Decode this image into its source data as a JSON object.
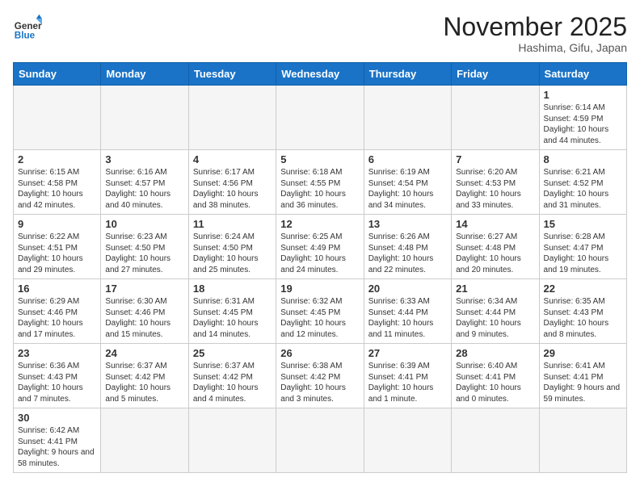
{
  "header": {
    "logo_general": "General",
    "logo_blue": "Blue",
    "month_title": "November 2025",
    "subtitle": "Hashima, Gifu, Japan"
  },
  "weekdays": [
    "Sunday",
    "Monday",
    "Tuesday",
    "Wednesday",
    "Thursday",
    "Friday",
    "Saturday"
  ],
  "weeks": [
    [
      {
        "day": "",
        "info": ""
      },
      {
        "day": "",
        "info": ""
      },
      {
        "day": "",
        "info": ""
      },
      {
        "day": "",
        "info": ""
      },
      {
        "day": "",
        "info": ""
      },
      {
        "day": "",
        "info": ""
      },
      {
        "day": "1",
        "info": "Sunrise: 6:14 AM\nSunset: 4:59 PM\nDaylight: 10 hours\nand 44 minutes."
      }
    ],
    [
      {
        "day": "2",
        "info": "Sunrise: 6:15 AM\nSunset: 4:58 PM\nDaylight: 10 hours\nand 42 minutes."
      },
      {
        "day": "3",
        "info": "Sunrise: 6:16 AM\nSunset: 4:57 PM\nDaylight: 10 hours\nand 40 minutes."
      },
      {
        "day": "4",
        "info": "Sunrise: 6:17 AM\nSunset: 4:56 PM\nDaylight: 10 hours\nand 38 minutes."
      },
      {
        "day": "5",
        "info": "Sunrise: 6:18 AM\nSunset: 4:55 PM\nDaylight: 10 hours\nand 36 minutes."
      },
      {
        "day": "6",
        "info": "Sunrise: 6:19 AM\nSunset: 4:54 PM\nDaylight: 10 hours\nand 34 minutes."
      },
      {
        "day": "7",
        "info": "Sunrise: 6:20 AM\nSunset: 4:53 PM\nDaylight: 10 hours\nand 33 minutes."
      },
      {
        "day": "8",
        "info": "Sunrise: 6:21 AM\nSunset: 4:52 PM\nDaylight: 10 hours\nand 31 minutes."
      }
    ],
    [
      {
        "day": "9",
        "info": "Sunrise: 6:22 AM\nSunset: 4:51 PM\nDaylight: 10 hours\nand 29 minutes."
      },
      {
        "day": "10",
        "info": "Sunrise: 6:23 AM\nSunset: 4:50 PM\nDaylight: 10 hours\nand 27 minutes."
      },
      {
        "day": "11",
        "info": "Sunrise: 6:24 AM\nSunset: 4:50 PM\nDaylight: 10 hours\nand 25 minutes."
      },
      {
        "day": "12",
        "info": "Sunrise: 6:25 AM\nSunset: 4:49 PM\nDaylight: 10 hours\nand 24 minutes."
      },
      {
        "day": "13",
        "info": "Sunrise: 6:26 AM\nSunset: 4:48 PM\nDaylight: 10 hours\nand 22 minutes."
      },
      {
        "day": "14",
        "info": "Sunrise: 6:27 AM\nSunset: 4:48 PM\nDaylight: 10 hours\nand 20 minutes."
      },
      {
        "day": "15",
        "info": "Sunrise: 6:28 AM\nSunset: 4:47 PM\nDaylight: 10 hours\nand 19 minutes."
      }
    ],
    [
      {
        "day": "16",
        "info": "Sunrise: 6:29 AM\nSunset: 4:46 PM\nDaylight: 10 hours\nand 17 minutes."
      },
      {
        "day": "17",
        "info": "Sunrise: 6:30 AM\nSunset: 4:46 PM\nDaylight: 10 hours\nand 15 minutes."
      },
      {
        "day": "18",
        "info": "Sunrise: 6:31 AM\nSunset: 4:45 PM\nDaylight: 10 hours\nand 14 minutes."
      },
      {
        "day": "19",
        "info": "Sunrise: 6:32 AM\nSunset: 4:45 PM\nDaylight: 10 hours\nand 12 minutes."
      },
      {
        "day": "20",
        "info": "Sunrise: 6:33 AM\nSunset: 4:44 PM\nDaylight: 10 hours\nand 11 minutes."
      },
      {
        "day": "21",
        "info": "Sunrise: 6:34 AM\nSunset: 4:44 PM\nDaylight: 10 hours\nand 9 minutes."
      },
      {
        "day": "22",
        "info": "Sunrise: 6:35 AM\nSunset: 4:43 PM\nDaylight: 10 hours\nand 8 minutes."
      }
    ],
    [
      {
        "day": "23",
        "info": "Sunrise: 6:36 AM\nSunset: 4:43 PM\nDaylight: 10 hours\nand 7 minutes."
      },
      {
        "day": "24",
        "info": "Sunrise: 6:37 AM\nSunset: 4:42 PM\nDaylight: 10 hours\nand 5 minutes."
      },
      {
        "day": "25",
        "info": "Sunrise: 6:37 AM\nSunset: 4:42 PM\nDaylight: 10 hours\nand 4 minutes."
      },
      {
        "day": "26",
        "info": "Sunrise: 6:38 AM\nSunset: 4:42 PM\nDaylight: 10 hours\nand 3 minutes."
      },
      {
        "day": "27",
        "info": "Sunrise: 6:39 AM\nSunset: 4:41 PM\nDaylight: 10 hours\nand 1 minute."
      },
      {
        "day": "28",
        "info": "Sunrise: 6:40 AM\nSunset: 4:41 PM\nDaylight: 10 hours\nand 0 minutes."
      },
      {
        "day": "29",
        "info": "Sunrise: 6:41 AM\nSunset: 4:41 PM\nDaylight: 9 hours\nand 59 minutes."
      }
    ],
    [
      {
        "day": "30",
        "info": "Sunrise: 6:42 AM\nSunset: 4:41 PM\nDaylight: 9 hours\nand 58 minutes."
      },
      {
        "day": "",
        "info": ""
      },
      {
        "day": "",
        "info": ""
      },
      {
        "day": "",
        "info": ""
      },
      {
        "day": "",
        "info": ""
      },
      {
        "day": "",
        "info": ""
      },
      {
        "day": "",
        "info": ""
      }
    ]
  ]
}
